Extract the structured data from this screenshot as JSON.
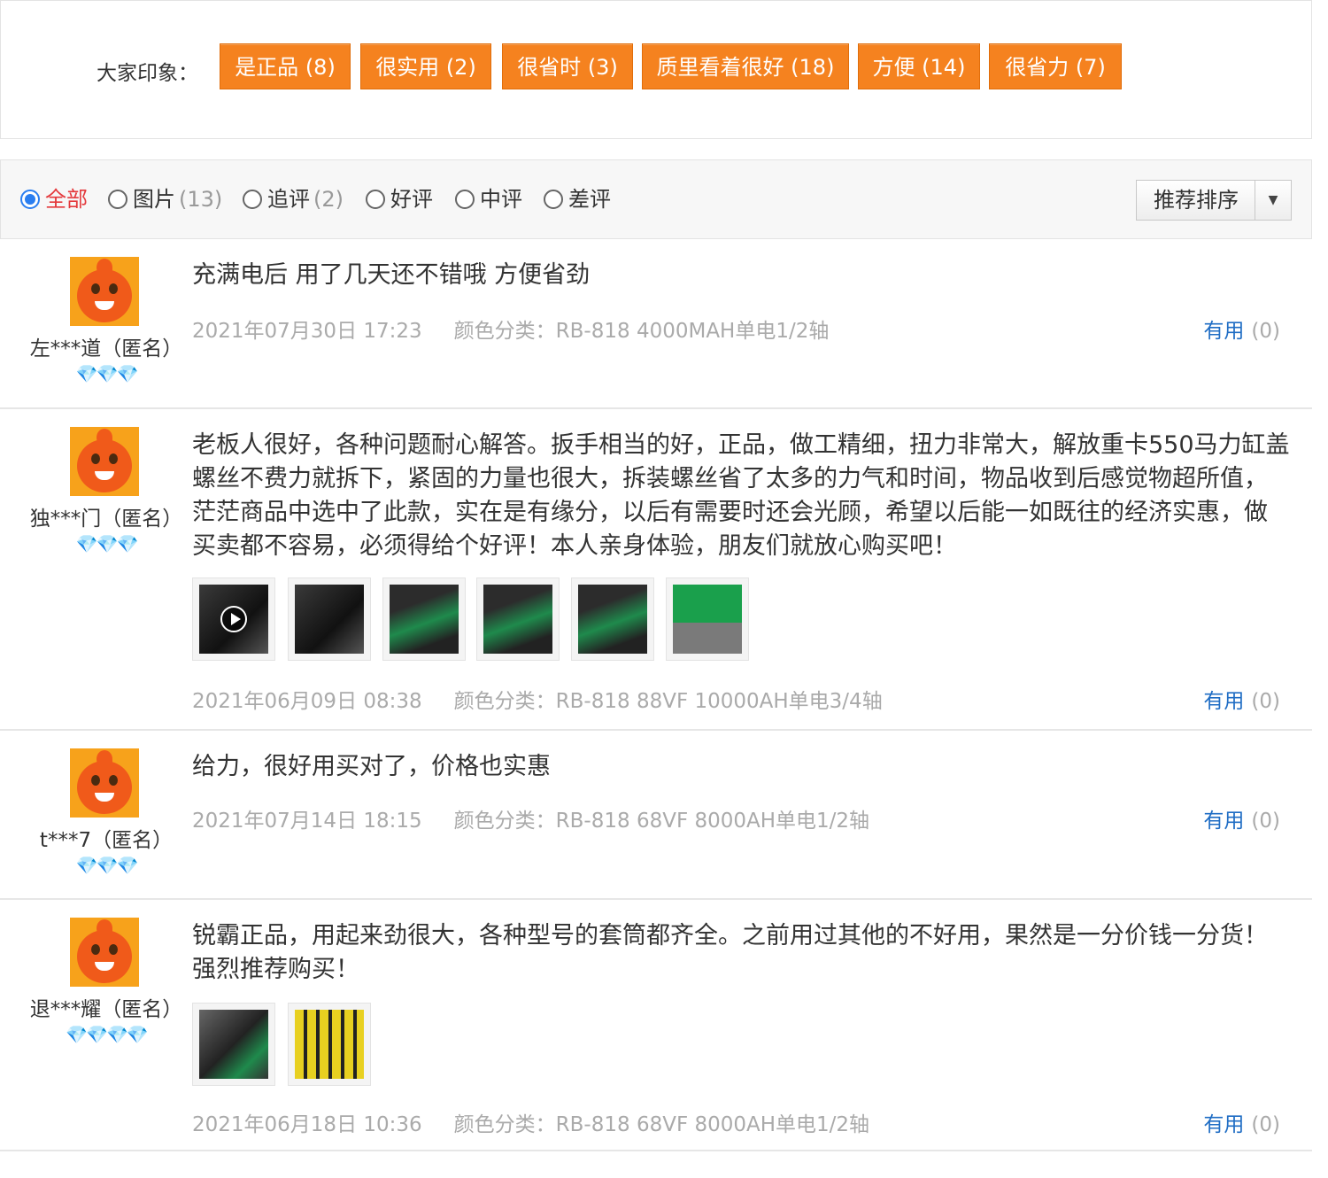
{
  "impressions": {
    "label": "大家印象：",
    "tags": [
      {
        "label": "是正品 (8)"
      },
      {
        "label": "很实用 (2)"
      },
      {
        "label": "很省时 (3)"
      },
      {
        "label": "质里看着很好 (18)"
      },
      {
        "label": "方便 (14)"
      },
      {
        "label": "很省力 (7)"
      }
    ]
  },
  "filter": {
    "options": [
      {
        "label": "全部",
        "count": "",
        "selected": true
      },
      {
        "label": "图片",
        "count": "(13)",
        "selected": false
      },
      {
        "label": "追评",
        "count": "(2)",
        "selected": false
      },
      {
        "label": "好评",
        "count": "",
        "selected": false
      },
      {
        "label": "中评",
        "count": "",
        "selected": false
      },
      {
        "label": "差评",
        "count": "",
        "selected": false
      }
    ],
    "sort_label": "推荐排序",
    "sort_arrow": "▼"
  },
  "reviews": [
    {
      "user": "左***道（匿名）",
      "diamonds": "💎💎💎",
      "content": "充满电后 用了几天还不错哦 方便省劲",
      "date": "2021年07月30日 17:23",
      "color": "颜色分类：RB-818 4000MAH单电1/2轴",
      "useful_label": "有用",
      "useful_count": "(0)"
    },
    {
      "user": "独***门（匿名）",
      "diamonds": "💎💎💎",
      "content": "老板人很好，各种问题耐心解答。扳手相当的好，正品，做工精细，扭力非常大，解放重卡550马力缸盖螺丝不费力就拆下，紧固的力量也很大，拆装螺丝省了太多的力气和时间，物品收到后感觉物超所值，茫茫商品中选中了此款，实在是有缘分，以后有需要时还会光顾，希望以后能一如既往的经济实惠，做买卖都不容易，必须得给个好评！本人亲身体验，朋友们就放心购买吧！",
      "date": "2021年06月09日 08:38",
      "color": "颜色分类：RB-818 88VF 10000AH单电3/4轴",
      "useful_label": "有用",
      "useful_count": "(0)"
    },
    {
      "user": "t***7（匿名）",
      "diamonds": "💎💎💎",
      "content": "给力，很好用买对了，价格也实惠",
      "date": "2021年07月14日 18:15",
      "color": "颜色分类：RB-818 68VF 8000AH单电1/2轴",
      "useful_label": "有用",
      "useful_count": "(0)"
    },
    {
      "user": "退***耀（匿名）",
      "diamonds": "💎💎💎💎",
      "content": "锐霸正品，用起来劲很大，各种型号的套筒都齐全。之前用过其他的不好用，果然是一分价钱一分货！强烈推荐购买！",
      "date": "2021年06月18日 10:36",
      "color": "颜色分类：RB-818 68VF 8000AH单电1/2轴",
      "useful_label": "有用",
      "useful_count": "(0)"
    }
  ],
  "colors": {
    "tag_bg": "#f5821f",
    "link_blue": "#1f6dc4",
    "active_red": "#e4393c",
    "diamond_blue": "#1e9ff2"
  }
}
